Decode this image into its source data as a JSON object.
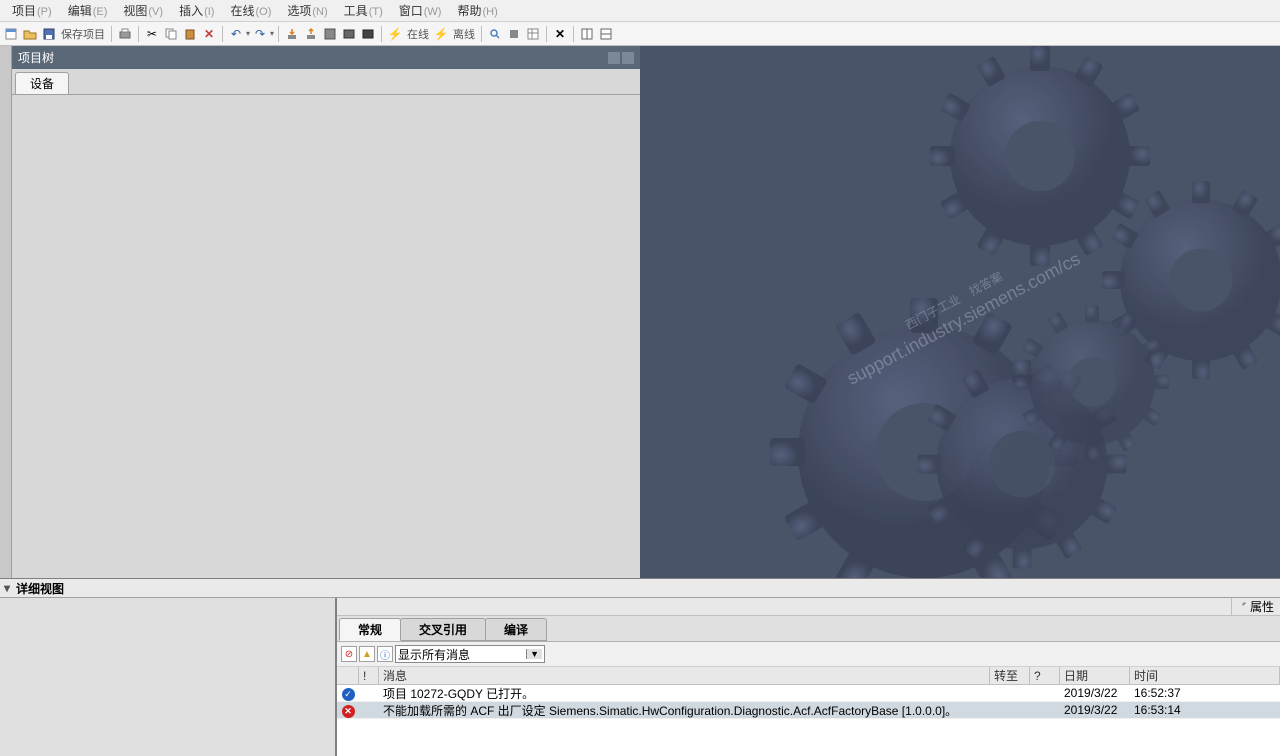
{
  "menubar": [
    {
      "label": "项目",
      "accel": "(P)"
    },
    {
      "label": "编辑",
      "accel": "(E)"
    },
    {
      "label": "视图",
      "accel": "(V)"
    },
    {
      "label": "插入",
      "accel": "(I)"
    },
    {
      "label": "在线",
      "accel": "(O)"
    },
    {
      "label": "选项",
      "accel": "(N)"
    },
    {
      "label": "工具",
      "accel": "(T)"
    },
    {
      "label": "窗口",
      "accel": "(W)"
    },
    {
      "label": "帮助",
      "accel": "(H)"
    }
  ],
  "toolbar": {
    "save_label": "保存项目",
    "online_label": "在线",
    "offline_label": "离线"
  },
  "project_tree": {
    "title": "项目树",
    "tab": "设备"
  },
  "watermark": {
    "line1": "西门子工业　找答案",
    "line2": "support.industry.siemens.com/cs"
  },
  "detail": {
    "title": "详细视图"
  },
  "props": {
    "label": "属性"
  },
  "bottom_tabs": [
    "常规",
    "交叉引用",
    "编译"
  ],
  "filter": {
    "select_label": "显示所有消息"
  },
  "msg_headers": {
    "bang": "!",
    "msg": "消息",
    "goto": "转至",
    "q": "?",
    "date": "日期",
    "time": "时间"
  },
  "messages": [
    {
      "type": "ok",
      "text": "项目 10272-GQDY 已打开。",
      "date": "2019/3/22",
      "time": "16:52:37",
      "sel": false
    },
    {
      "type": "err",
      "text": "不能加载所需的 ACF 出厂设定 Siemens.Simatic.HwConfiguration.Diagnostic.Acf.AcfFactoryBase [1.0.0.0]。",
      "date": "2019/3/22",
      "time": "16:53:14",
      "sel": true
    }
  ]
}
